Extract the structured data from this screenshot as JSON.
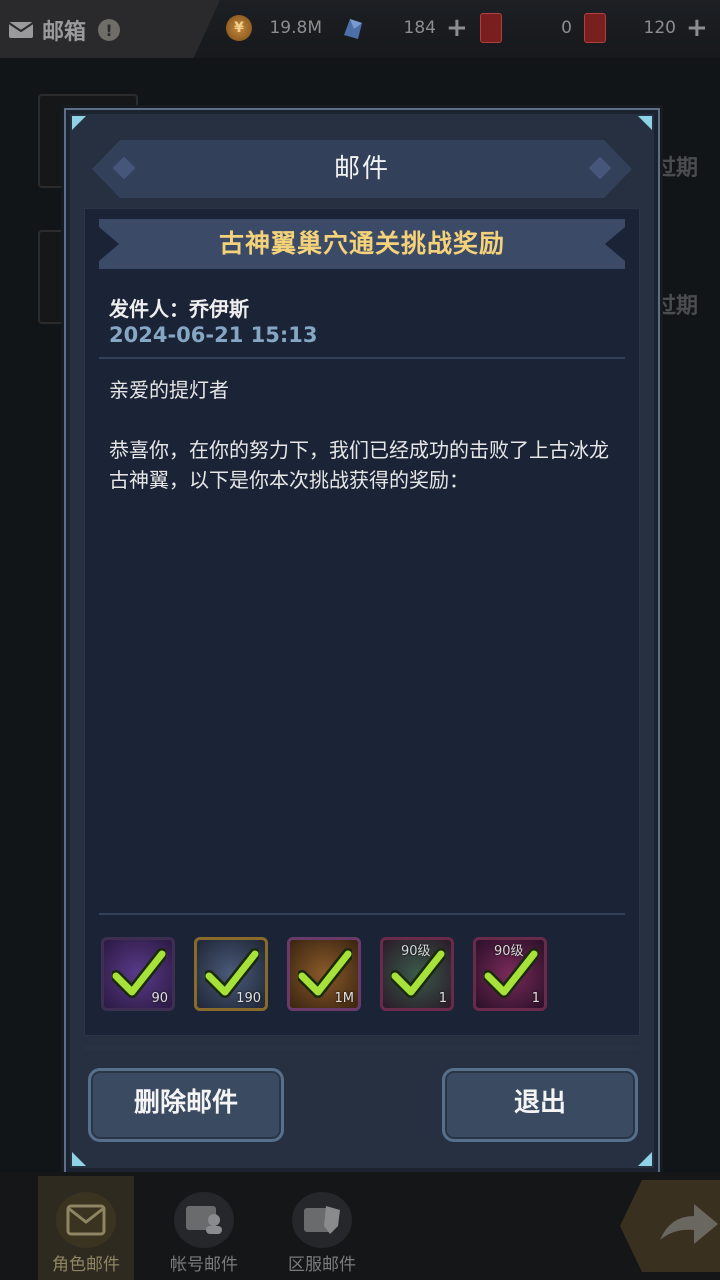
{
  "topbar": {
    "title": "邮箱",
    "badge": "!",
    "resources": [
      {
        "icon": "gold-coin-icon",
        "value": "19.8M",
        "has_plus": false
      },
      {
        "icon": "crystal-icon",
        "value": "184",
        "has_plus": true
      },
      {
        "icon": "red-card-icon",
        "value": "0",
        "has_plus": false
      },
      {
        "icon": "ticket-icon",
        "value": "120",
        "has_plus": true
      }
    ]
  },
  "background_list": {
    "expired_label": "过期"
  },
  "dialog": {
    "header": "邮件",
    "subject": "古神翼巢穴通关挑战奖励",
    "sender_label": "发件人：",
    "sender_name": "乔伊斯",
    "date": "2024-06-21 15:13",
    "body": "亲爱的提灯者\n\n恭喜你，在你的努力下，我们已经成功的击败了上古冰龙古神翼，以下是你本次挑战获得的奖励：",
    "rewards": [
      {
        "icon": "scroll-icon",
        "quantity": "90",
        "level": "",
        "claimed": true
      },
      {
        "icon": "armor-icon",
        "quantity": "190",
        "level": "",
        "claimed": true
      },
      {
        "icon": "medal-icon",
        "quantity": "1M",
        "level": "",
        "claimed": true
      },
      {
        "icon": "weapon-icon",
        "quantity": "1",
        "level": "90级",
        "claimed": true
      },
      {
        "icon": "gear-icon",
        "quantity": "1",
        "level": "90级",
        "claimed": true
      }
    ],
    "delete_button": "删除邮件",
    "exit_button": "退出"
  },
  "bottom_tabs": [
    {
      "label": "角色邮件",
      "active": true
    },
    {
      "label": "帐号邮件",
      "active": false
    },
    {
      "label": "区服邮件",
      "active": false
    }
  ]
}
